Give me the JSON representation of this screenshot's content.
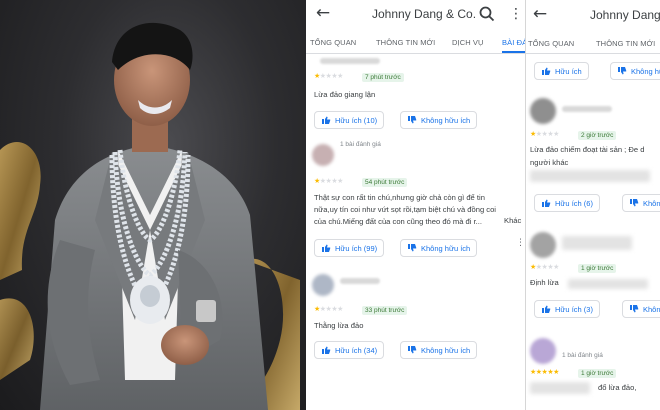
{
  "photo": {
    "alt_subject": ""
  },
  "screen_left": {
    "title": "Johnny Dang & Co.",
    "icons": {
      "back": "back-arrow-icon",
      "search": "search-icon",
      "more": "more-vert-icon"
    },
    "tabs": [
      {
        "label": "TỔNG QUAN",
        "active": false
      },
      {
        "label": "THÔNG TIN MỚI",
        "active": false
      },
      {
        "label": "DỊCH VỤ",
        "active": false
      },
      {
        "label": "BÀI ĐÁNH",
        "active": true
      }
    ],
    "reviews": [
      {
        "rating": 1,
        "time": "7 phút trước",
        "text": "Lừa đảo giang lận",
        "helpful": "Hữu ích (10)",
        "not_helpful": "Không hữu ích"
      },
      {
        "count": "1 bài đánh giá",
        "rating": 1,
        "time": "54 phút trước",
        "text_lines": [
          "Thật sự con rất tin chú,nhưng giờ chả còn gì để tin",
          "nữa,uy tín coi như vứt sọt rồi,tạm biệt chú và đồng coi",
          "của chú.Miếng đất của con cũng theo đó mà đi r..."
        ],
        "more": "Khác",
        "helpful": "Hữu ích (99)",
        "not_helpful": "Không hữu ích"
      },
      {
        "rating": 1,
        "time": "33 phút trước",
        "text": "Thằng lừa đảo",
        "helpful": "Hữu ích (34)",
        "not_helpful": "Không hữu ích"
      }
    ]
  },
  "screen_right": {
    "title": "Johnny Dang",
    "tabs": [
      {
        "label": "TỔNG QUAN",
        "active": false
      },
      {
        "label": "THÔNG TIN MỚI",
        "active": false
      }
    ],
    "reviews": [
      {
        "helpful": "Hữu ích",
        "not_helpful": "Không hữ"
      },
      {
        "rating": 1,
        "time": "2 giờ trước",
        "text_lines": [
          "Lừa đảo chiếm đoạt tài sản ; Đe d",
          "người khác"
        ],
        "helpful": "Hữu ích (6)",
        "not_helpful": "Khôn"
      },
      {
        "rating": 1,
        "time": "1 giờ trước",
        "text": "Định lừa",
        "helpful": "Hữu ích (3)",
        "not_helpful": "Khôn"
      },
      {
        "count": "1 bài đánh giá",
        "rating": 5,
        "time": "1 giờ trước",
        "text": "đổ lừa đảo,"
      }
    ]
  },
  "colors": {
    "accent": "#1a73e8",
    "star": "#fbbc04",
    "badge_bg": "#e6f4ea",
    "badge_text": "#3c7a37"
  }
}
